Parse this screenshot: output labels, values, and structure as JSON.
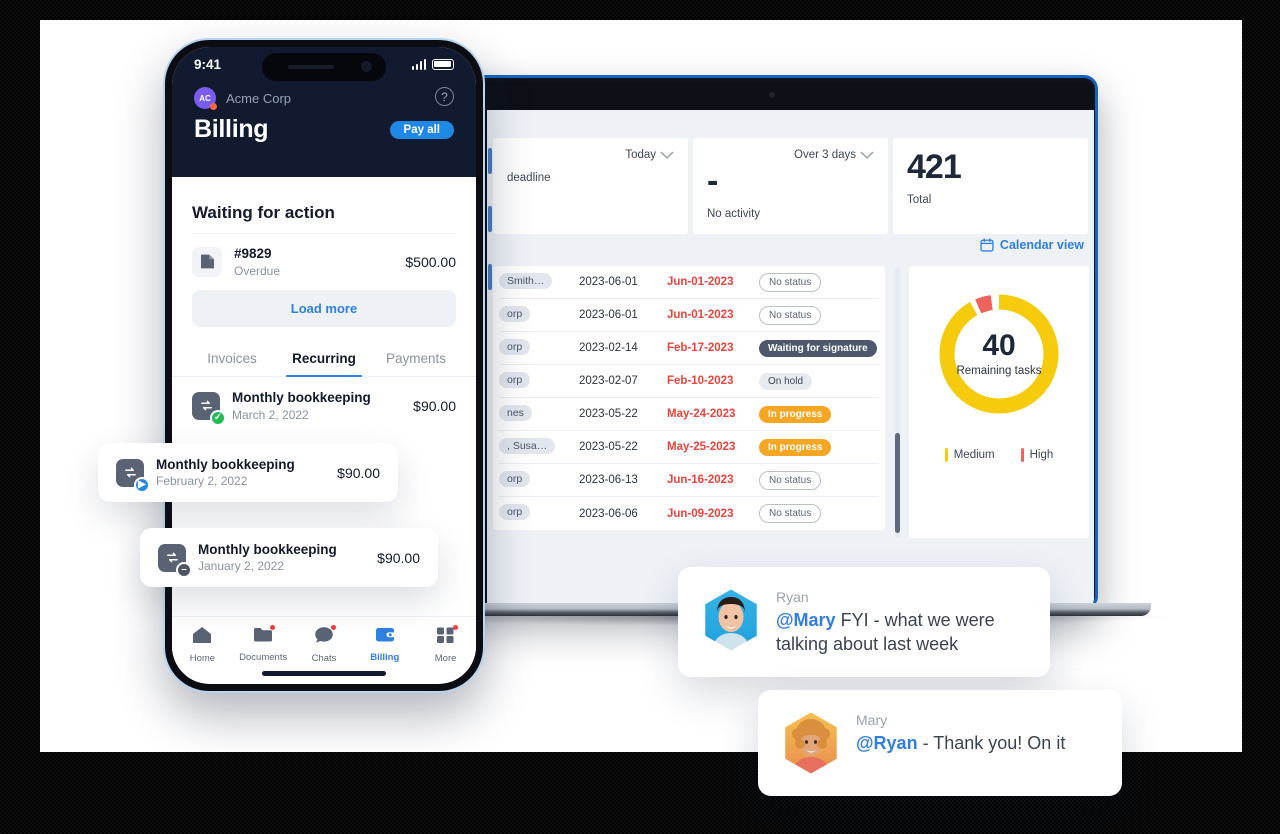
{
  "phone": {
    "status": {
      "time": "9:41",
      "signal_icon": "signal-bars-icon",
      "battery_icon": "battery-icon"
    },
    "org": {
      "avatar_initials": "AC",
      "name": "Acme Corp",
      "help_icon": "help-circle-icon"
    },
    "title": "Billing",
    "pay_all_label": "Pay all",
    "sheet_heading": "Waiting for action",
    "invoice": {
      "icon": "document-icon",
      "number": "#9829",
      "status": "Overdue",
      "amount": "$500.00"
    },
    "load_more_label": "Load more",
    "tabs": [
      {
        "label": "Invoices",
        "active": false
      },
      {
        "label": "Recurring",
        "active": true
      },
      {
        "label": "Payments",
        "active": false
      }
    ],
    "recurring": {
      "icon": "recurring-arrows-icon",
      "badge": "check-badge-icon",
      "title": "Monthly bookkeeping",
      "date": "March 2, 2022",
      "amount": "$90.00"
    },
    "nav": [
      {
        "label": "Home",
        "icon": "home-icon",
        "active": false,
        "dot": false
      },
      {
        "label": "Documents",
        "icon": "folder-icon",
        "active": false,
        "dot": true
      },
      {
        "label": "Chats",
        "icon": "chat-bubble-icon",
        "active": false,
        "dot": true
      },
      {
        "label": "Billing",
        "icon": "wallet-icon",
        "active": true,
        "dot": false
      },
      {
        "label": "More",
        "icon": "grid-plus-icon",
        "active": false,
        "dot": true
      }
    ]
  },
  "float_cards": [
    {
      "icon": "recurring-arrows-icon",
      "badge": "play-badge-icon",
      "title": "Monthly bookkeeping",
      "date": "February 2, 2022",
      "amount": "$90.00"
    },
    {
      "icon": "recurring-arrows-icon",
      "badge": "minus-badge-icon",
      "title": "Monthly bookkeeping",
      "date": "January 2, 2022",
      "amount": "$90.00"
    }
  ],
  "dashboard": {
    "stats": [
      {
        "selector": "Today",
        "selector_icon": "chevron-down-icon",
        "value": "",
        "label": "deadline"
      },
      {
        "selector": "Over 3 days",
        "selector_icon": "chevron-down-icon",
        "value": "-",
        "label": "No activity"
      },
      {
        "selector": "",
        "selector_icon": "",
        "value": "421",
        "label": "Total"
      }
    ],
    "calendar_view": {
      "label": "Calendar view",
      "icon": "calendar-icon"
    },
    "table": {
      "rows": [
        {
          "name": "Smith…",
          "date": "2023-06-01",
          "due": "Jun-01-2023",
          "status": "No status",
          "status_kind": "none"
        },
        {
          "name": "orp",
          "date": "2023-06-01",
          "due": "Jun-01-2023",
          "status": "No status",
          "status_kind": "none"
        },
        {
          "name": "orp",
          "date": "2023-02-14",
          "due": "Feb-17-2023",
          "status": "Waiting for signature",
          "status_kind": "wait"
        },
        {
          "name": "orp",
          "date": "2023-02-07",
          "due": "Feb-10-2023",
          "status": "On hold",
          "status_kind": "hold"
        },
        {
          "name": "nes",
          "date": "2023-05-22",
          "due": "May-24-2023",
          "status": "In progress",
          "status_kind": "prog"
        },
        {
          "name": ", Susa…",
          "date": "2023-05-22",
          "due": "May-25-2023",
          "status": "In progress",
          "status_kind": "prog"
        },
        {
          "name": "orp",
          "date": "2023-06-13",
          "due": "Jun-16-2023",
          "status": "No status",
          "status_kind": "none"
        },
        {
          "name": "orp",
          "date": "2023-06-06",
          "due": "Jun-09-2023",
          "status": "No status",
          "status_kind": "none"
        }
      ]
    },
    "chart_data": {
      "type": "pie",
      "title": "Remaining tasks",
      "center_value": "40",
      "center_label": "Remaining tasks",
      "categories": [
        "Medium",
        "High"
      ],
      "values": [
        37,
        3
      ],
      "colors": [
        "#f5cb0b",
        "#f0635a"
      ],
      "legend": [
        {
          "label": "Medium",
          "color": "#f5cb0b"
        },
        {
          "label": "High",
          "color": "#f0635a"
        }
      ],
      "legend_position": "bottom",
      "grid": false
    }
  },
  "chats": [
    {
      "name": "Ryan",
      "mention": "@Mary",
      "message": " FYI - what we were talking about last week",
      "avatar": "ryan-avatar"
    },
    {
      "name": "Mary",
      "mention": "@Ryan",
      "message": " - Thank you! On it",
      "avatar": "mary-avatar"
    }
  ],
  "colors": {
    "accent_blue": "#2f80e0",
    "danger_red": "#e8443c",
    "warn_orange": "#f5a623",
    "chart_yellow": "#f5cb0b",
    "chart_red": "#f0635a",
    "dark_navy": "#111a2e"
  }
}
